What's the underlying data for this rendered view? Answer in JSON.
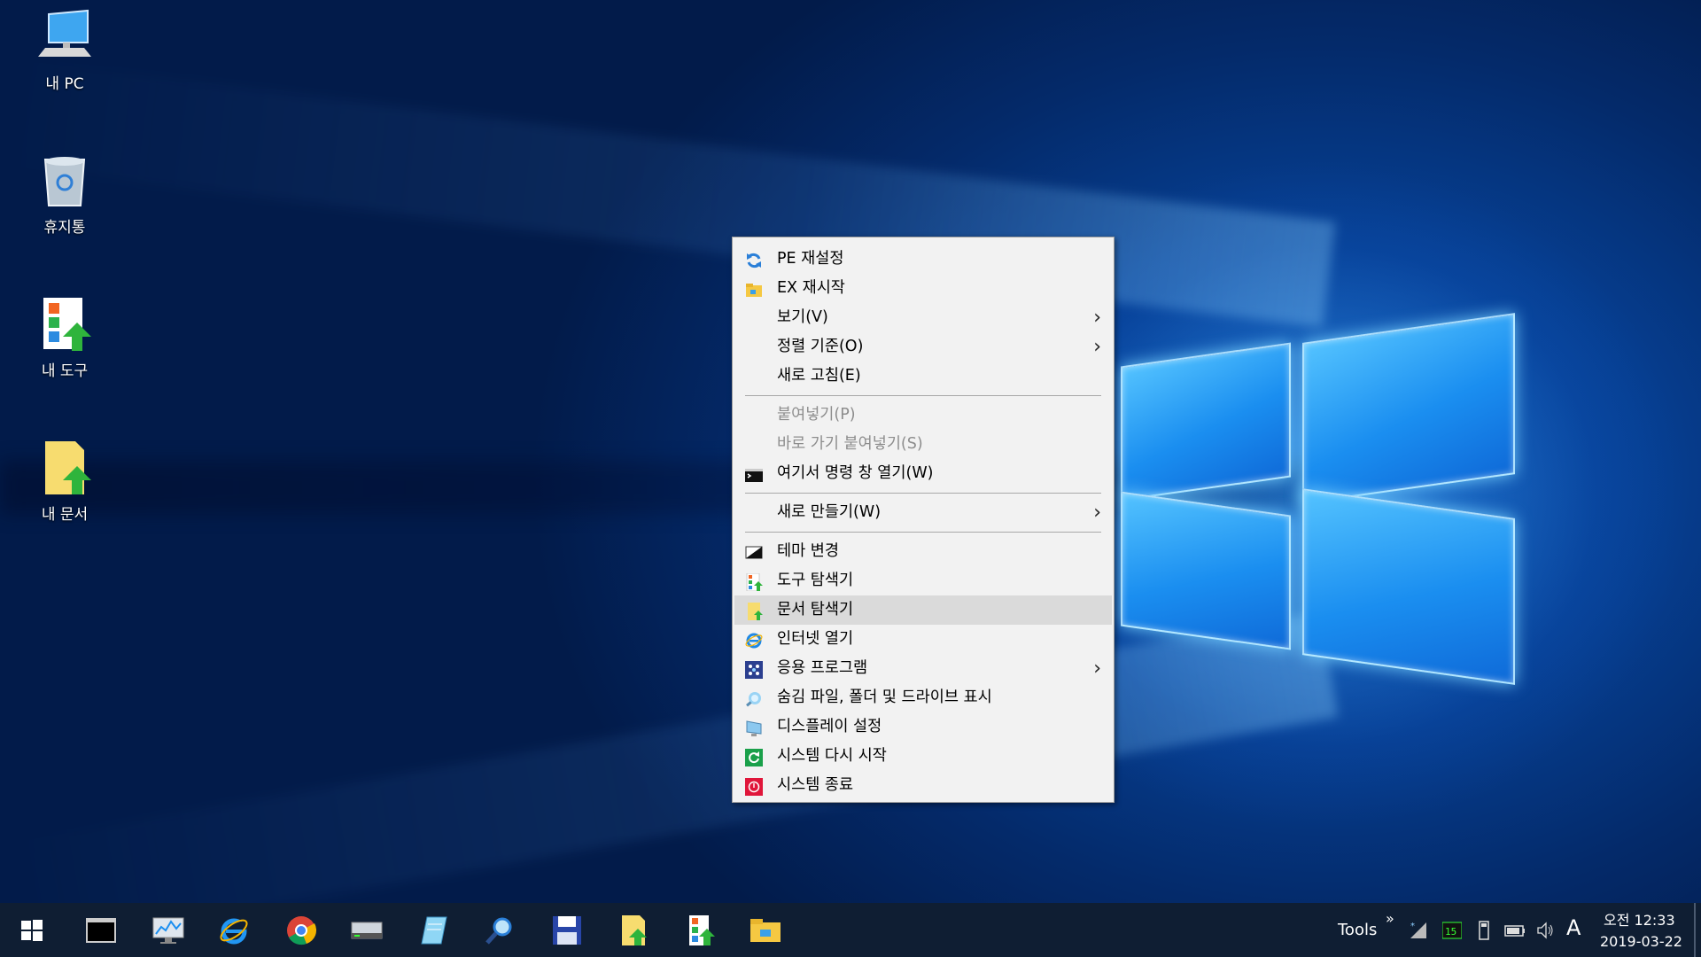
{
  "desktop_icons": [
    {
      "label": "내 PC",
      "icon": "computer-icon"
    },
    {
      "label": "휴지통",
      "icon": "recycle-bin-icon"
    },
    {
      "label": "내 도구",
      "icon": "tools-shortcut-icon"
    },
    {
      "label": "내 문서",
      "icon": "documents-shortcut-icon"
    }
  ],
  "menu": {
    "items": [
      {
        "label": "PE 재설정",
        "icon": "refresh-icon"
      },
      {
        "label": "EX 재시작",
        "icon": "folder-icon"
      },
      {
        "label": "보기(V)",
        "submenu": true
      },
      {
        "label": "정렬 기준(O)",
        "submenu": true
      },
      {
        "label": "새로 고침(E)"
      },
      {
        "label": "붙여넣기(P)",
        "disabled": true
      },
      {
        "label": "바로 가기 붙여넣기(S)",
        "disabled": true
      },
      {
        "label": "여기서 명령 창 열기(W)",
        "icon": "cmd-icon"
      },
      {
        "label": "새로 만들기(W)",
        "submenu": true
      },
      {
        "label": "테마 변경",
        "icon": "theme-icon"
      },
      {
        "label": "도구 탐색기",
        "icon": "tools-icon"
      },
      {
        "label": "문서 탐색기",
        "icon": "document-icon",
        "highlighted": true
      },
      {
        "label": "인터넷 열기",
        "icon": "ie-icon"
      },
      {
        "label": "응용 프로그램",
        "icon": "apps-icon",
        "submenu": true
      },
      {
        "label": "숨김 파일, 폴더 및 드라이브 표시",
        "icon": "hidden-files-icon"
      },
      {
        "label": "디스플레이 설정",
        "icon": "display-icon"
      },
      {
        "label": "시스템 다시 시작",
        "icon": "restart-icon"
      },
      {
        "label": "시스템 종료",
        "icon": "shutdown-icon"
      }
    ]
  },
  "taskbar": {
    "apps": [
      "start-icon",
      "cmd-icon",
      "monitor-icon",
      "ie-icon",
      "chrome-icon",
      "drive-icon",
      "notepad-icon",
      "search-icon",
      "save-icon",
      "documents-icon",
      "tools-icon",
      "explorer-icon"
    ],
    "tools_label": "Tools",
    "ime": "A",
    "time": "오전 12:33",
    "date": "2019-03-22"
  },
  "colors": {
    "menu_bg": "#f2f2f2",
    "highlight": "#dadada",
    "taskbar": "#0f1e33"
  }
}
